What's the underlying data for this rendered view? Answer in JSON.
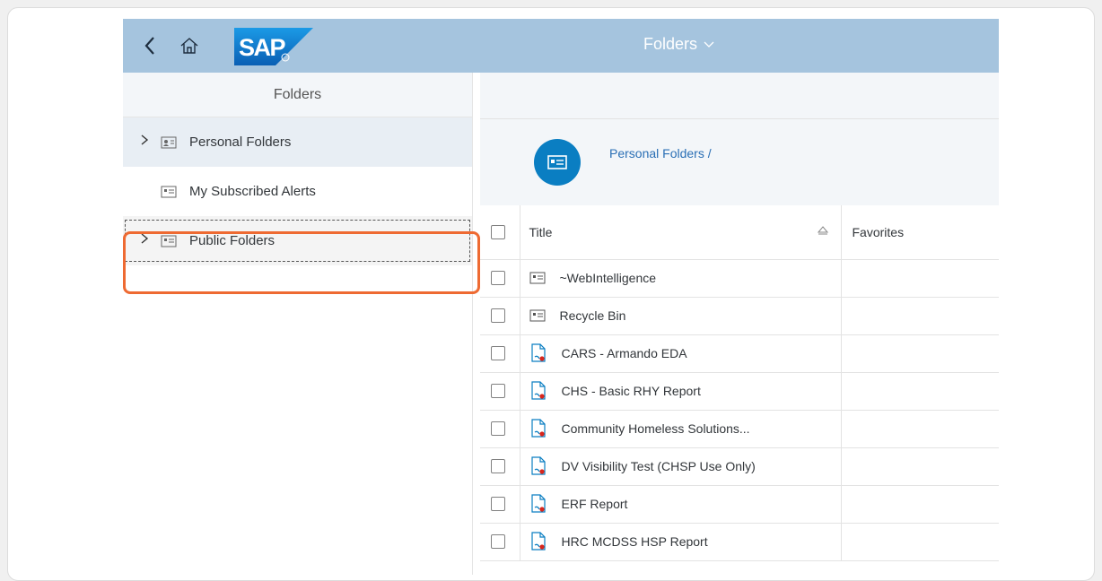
{
  "header": {
    "logo_text": "SAP",
    "title": "Folders",
    "title_chevron": "⌵",
    "back_icon": "chevron-left-icon",
    "home_icon": "home-icon",
    "bar_color": "#a5c4de"
  },
  "nav": {
    "title": "Folders",
    "items": [
      {
        "label": "Personal Folders",
        "expandable": true,
        "icon": "personal-folder-icon"
      },
      {
        "label": "My Subscribed Alerts",
        "expandable": false,
        "icon": "alerts-folder-icon"
      },
      {
        "label": "Public Folders",
        "expandable": true,
        "icon": "public-folder-icon"
      }
    ]
  },
  "breadcrumb": {
    "label": "Personal Folders /"
  },
  "table": {
    "columns": [
      "Title",
      "Favorites"
    ],
    "rows": [
      {
        "title": "~WebIntelligence",
        "icon": "folder-icon"
      },
      {
        "title": "Recycle Bin",
        "icon": "folder-icon"
      },
      {
        "title": "CARS - Armando EDA",
        "icon": "document-icon"
      },
      {
        "title": "CHS - Basic RHY Report",
        "icon": "document-icon"
      },
      {
        "title": "Community Homeless Solutions...",
        "icon": "document-icon"
      },
      {
        "title": "DV Visibility Test (CHSP Use Only)",
        "icon": "document-icon"
      },
      {
        "title": "ERF Report",
        "icon": "document-icon"
      },
      {
        "title": "HRC MCDSS HSP Report",
        "icon": "document-icon"
      }
    ]
  },
  "colors": {
    "accent": "#0a7ec2",
    "highlight": "#ee6a32",
    "link": "#2a6fb5"
  }
}
